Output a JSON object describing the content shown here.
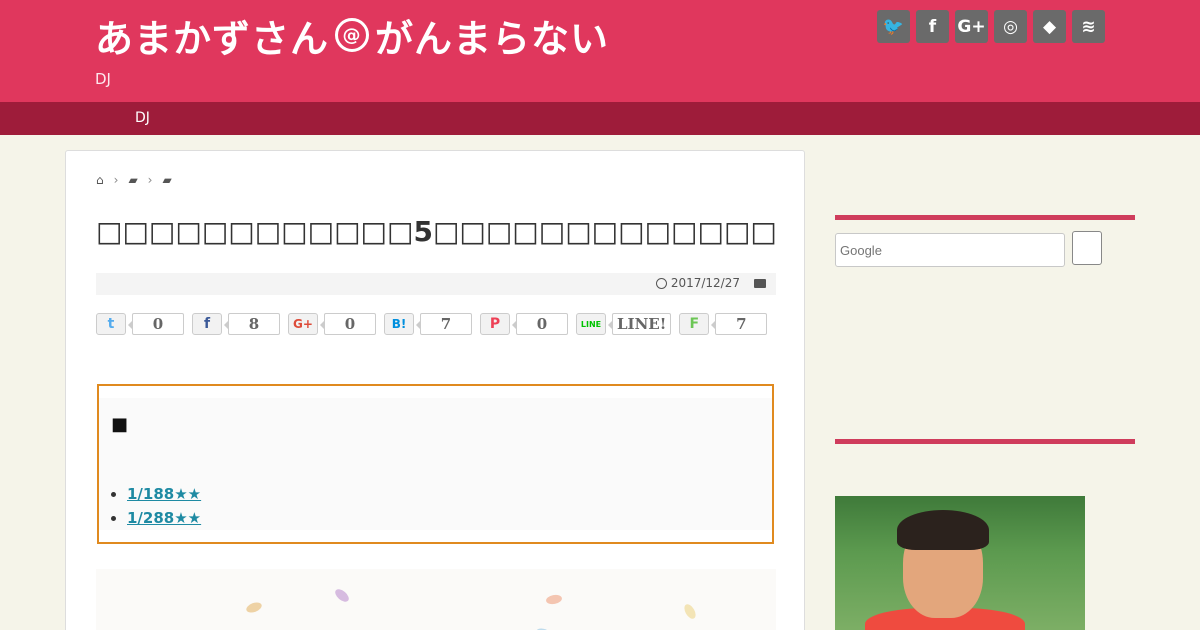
{
  "header": {
    "logo_part1": "あまかずさん",
    "logo_at": "@",
    "logo_part2": "がんまらない",
    "description": "DJ",
    "social_icons": [
      {
        "name": "twitter-icon",
        "glyph": "🐦"
      },
      {
        "name": "facebook-icon",
        "glyph": "f"
      },
      {
        "name": "google-plus-icon",
        "glyph": "G+"
      },
      {
        "name": "instagram-icon",
        "glyph": "◎"
      },
      {
        "name": "feedly-icon",
        "glyph": "◆"
      },
      {
        "name": "rss-icon",
        "glyph": "≋"
      }
    ]
  },
  "nav": {
    "item": "DJ"
  },
  "article": {
    "breadcrumb_home_icon": "home-icon",
    "breadcrumb_sep": "›",
    "title": "□□□□□□□□□□□□5□□□□□□□□□□□□□□□□□□□□□",
    "date": "2017/12/27",
    "share": [
      {
        "service": "twitter",
        "label": "t",
        "count": "0",
        "color": "#55acee"
      },
      {
        "service": "facebook",
        "label": "f",
        "count": "8",
        "color": "#3b5998"
      },
      {
        "service": "google-plus",
        "label": "G+",
        "count": "0",
        "color": "#dd4b39"
      },
      {
        "service": "hatena",
        "label": "B!",
        "count": "7",
        "color": "#008fde"
      },
      {
        "service": "pocket",
        "label": "P",
        "count": "0",
        "color": "#ee4056"
      },
      {
        "service": "line",
        "label": "LINE",
        "count": "LINE!",
        "color": "#00c300"
      },
      {
        "service": "feedly",
        "label": "F",
        "count": "7",
        "color": "#6cc655"
      }
    ],
    "notice": {
      "heading": "■",
      "links": [
        "1/188★★",
        "1/288★★"
      ]
    }
  },
  "sidebar": {
    "search_placeholder": "Google"
  },
  "colors": {
    "header_bg": "#e0375d",
    "nav_bg": "#9e1c3a",
    "page_bg": "#f5f4e9",
    "accent_rule": "#cf3c5c",
    "notice_border": "#e08a1f",
    "link": "#1e8aa3"
  }
}
